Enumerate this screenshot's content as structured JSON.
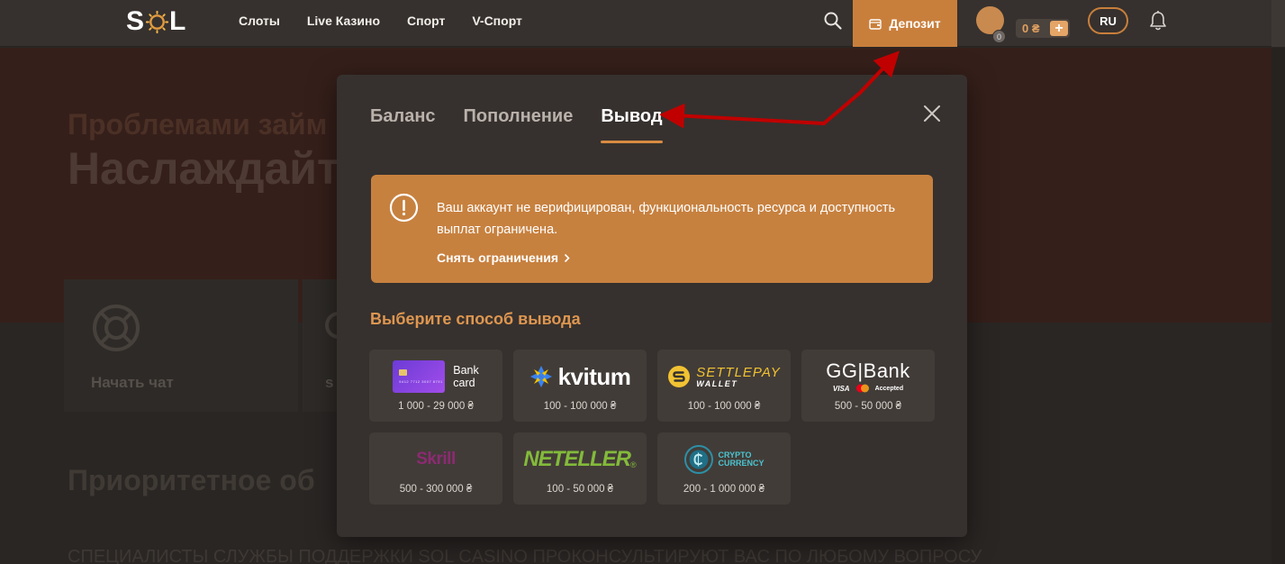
{
  "header": {
    "logo_left": "S",
    "logo_right": "L",
    "nav": [
      "Слоты",
      "Live Казино",
      "Спорт",
      "V-Спорт"
    ],
    "deposit_label": "Депозит",
    "avatar_badge": "0",
    "balance": "0 ₴",
    "balance_plus": "+",
    "language": "RU"
  },
  "background": {
    "hero_line1": "Проблемами займ",
    "hero_line2": "Наслаждайте",
    "chat_label": "Начать чат",
    "card2_label": "s",
    "priority_heading": "Приоритетное об",
    "bottom_text": "СПЕЦИАЛИСТЫ СЛУЖБЫ ПОДДЕРЖКИ SOL CASINO ПРОКОНСУЛЬТИРУЮТ ВАС ПО ЛЮБОМУ ВОПРОСУ"
  },
  "modal": {
    "tabs": [
      {
        "label": "Баланс",
        "active": false
      },
      {
        "label": "Пополнение",
        "active": false
      },
      {
        "label": "Вывод",
        "active": true
      }
    ],
    "warning": {
      "text": "Ваш аккаунт не верифицирован, функциональность ресурса и доступность выплат ограничена.",
      "link": "Снять ограничения"
    },
    "method_title": "Выберите способ вывода",
    "methods": [
      {
        "id": "bank-card",
        "logo_line1": "Bank",
        "logo_line2": "card",
        "card_number": "5412 7712 3007 8791",
        "range": "1 000 - 29 000 ₴"
      },
      {
        "id": "kvitum",
        "logo": "kvitum",
        "range": "100 - 100 000 ₴"
      },
      {
        "id": "settlepay",
        "logo": "SETTLEPAY",
        "logo_sub": "WALLET",
        "range": "100 - 100 000 ₴"
      },
      {
        "id": "ggbank",
        "logo": "GG|Bank",
        "visa": "VISA",
        "accepted": "Accepted",
        "range": "500 - 50 000 ₴"
      },
      {
        "id": "skrill",
        "logo": "Skrill",
        "range": "500 - 300 000 ₴"
      },
      {
        "id": "neteller",
        "logo": "NETELLER",
        "logo_mark": "®",
        "range": "100 - 50 000 ₴"
      },
      {
        "id": "crypto",
        "logo_line1": "CRYPTO",
        "logo_line2": "CURRENCY",
        "range": "200 - 1 000 000 ₴"
      }
    ]
  },
  "colors": {
    "accent": "#c97f3c",
    "warning_bg": "#c7813f",
    "title_orange": "#de9650",
    "modal_bg": "#36312e",
    "method_bg": "#423c38",
    "annotation_red": "#c00000"
  }
}
